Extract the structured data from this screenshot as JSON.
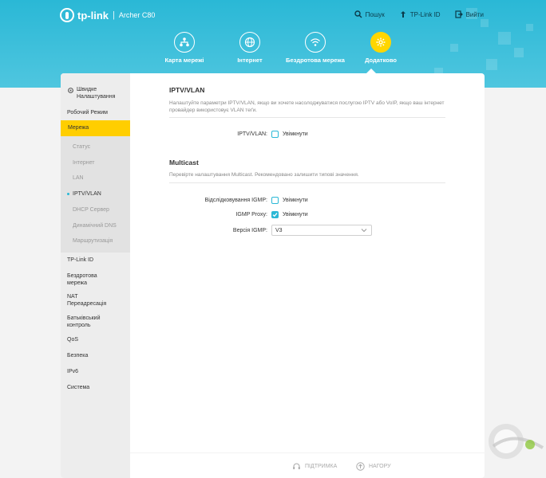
{
  "header": {
    "brand": "tp-link",
    "separator": "|",
    "model": "Archer C80",
    "links": [
      {
        "label": "Пошук",
        "icon": "search-icon"
      },
      {
        "label": "TP-Link ID",
        "icon": "tplink-id-icon"
      },
      {
        "label": "Вийти",
        "icon": "logout-icon"
      }
    ],
    "nav": [
      {
        "label": "Карта мережі",
        "icon": "network-map-icon"
      },
      {
        "label": "Інтернет",
        "icon": "globe-icon"
      },
      {
        "label": "Бездротова мережа",
        "icon": "wifi-icon"
      },
      {
        "label": "Додатково",
        "icon": "gear-icon",
        "active": true
      }
    ]
  },
  "sidebar": {
    "quick_setup": "Швидке Налаштування",
    "operation_mode": "Робочий Режим",
    "active": "Мережа",
    "sub_items": [
      "Статус",
      "Інтернет",
      "LAN",
      "IPTV/VLAN",
      "DHCP Сервер",
      "Динамічний DNS",
      "Маршрутизація"
    ],
    "current_sub": "IPTV/VLAN",
    "items": [
      "TP-Link ID",
      "Бездротова мережа",
      "NAT Переадресація",
      "Батьківський контроль",
      "QoS",
      "Безпека",
      "IPv6",
      "Система"
    ]
  },
  "iptv": {
    "title": "IPTV/VLAN",
    "desc": "Налаштуйте параметри IPTV/VLAN, якщо ви хочете насолоджуватися послугою IPTV або VoIP, якщо ваш інтернет провайдер використовує VLAN теґи.",
    "label": "IPTV/VLAN:",
    "option": "Увімкнути",
    "checked": false
  },
  "multicast": {
    "title": "Multicast",
    "desc": "Перевірте налаштування Multicast. Рекомендовано залишити типові значення.",
    "snooping_label": "Відслідковування IGMP:",
    "snooping_option": "Увімкнути",
    "snooping_checked": false,
    "proxy_label": "IGMP Proxy:",
    "proxy_option": "Увімкнути",
    "proxy_checked": true,
    "version_label": "Версія IGMP:",
    "version_value": "V3"
  },
  "footer": {
    "support": "ПІДТРИМКА",
    "top": "НАГОРУ"
  },
  "colors": {
    "accent": "#2ab8d6",
    "active": "#ffce00"
  }
}
